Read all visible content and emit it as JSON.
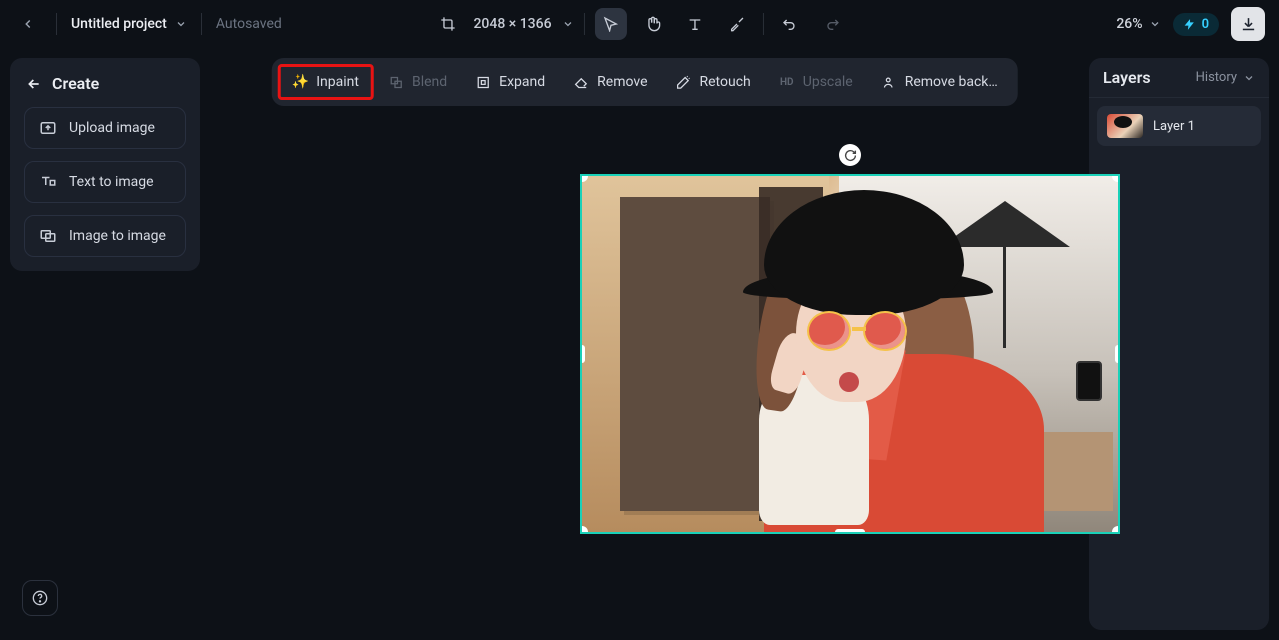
{
  "header": {
    "project_name": "Untitled project",
    "autosaved": "Autosaved",
    "dimensions": "2048 × 1366",
    "zoom": "26%",
    "credits": "0"
  },
  "sidebar": {
    "create_label": "Create",
    "upload": "Upload image",
    "text_to_image": "Text to image",
    "image_to_image": "Image to image"
  },
  "toolbar": {
    "inpaint": "Inpaint",
    "blend": "Blend",
    "expand": "Expand",
    "remove": "Remove",
    "retouch": "Retouch",
    "upscale": "Upscale",
    "remove_bg": "Remove back…"
  },
  "layers": {
    "title": "Layers",
    "history": "History",
    "layer1": "Layer 1"
  }
}
